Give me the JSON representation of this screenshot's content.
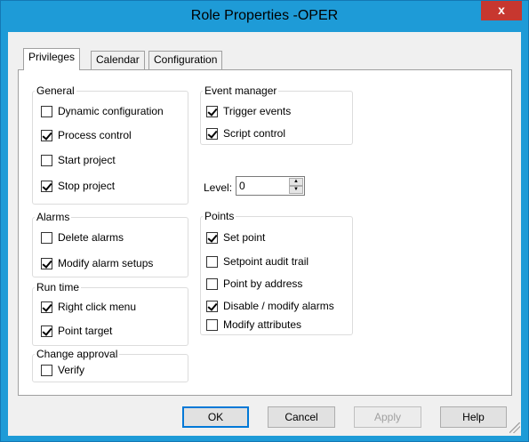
{
  "window": {
    "title": "Role Properties -OPER",
    "close_glyph": "x"
  },
  "tabs": [
    {
      "label": "Privileges",
      "active": true
    },
    {
      "label": "Calendar",
      "active": false
    },
    {
      "label": "Configuration",
      "active": false
    }
  ],
  "general": {
    "legend": "General",
    "items": [
      {
        "label": "Dynamic configuration",
        "checked": false
      },
      {
        "label": "Process control",
        "checked": true
      },
      {
        "label": "Start project",
        "checked": false
      },
      {
        "label": "Stop project",
        "checked": true
      }
    ]
  },
  "alarms": {
    "legend": "Alarms",
    "items": [
      {
        "label": "Delete alarms",
        "checked": false
      },
      {
        "label": "Modify alarm setups",
        "checked": true
      }
    ]
  },
  "runtime": {
    "legend": "Run time",
    "items": [
      {
        "label": "Right click menu",
        "checked": true
      },
      {
        "label": "Point target",
        "checked": true
      }
    ]
  },
  "change_approval": {
    "legend": "Change approval",
    "items": [
      {
        "label": "Verify",
        "checked": false
      }
    ]
  },
  "event_manager": {
    "legend": "Event manager",
    "items": [
      {
        "label": "Trigger events",
        "checked": true
      },
      {
        "label": "Script control",
        "checked": true
      }
    ]
  },
  "level": {
    "label": "Level:",
    "value": "0"
  },
  "points": {
    "legend": "Points",
    "items": [
      {
        "label": "Set point",
        "checked": true
      },
      {
        "label": "Setpoint audit trail",
        "checked": false
      },
      {
        "label": "Point by address",
        "checked": false
      },
      {
        "label": "Disable / modify alarms",
        "checked": true
      },
      {
        "label": "Modify attributes",
        "checked": false
      }
    ]
  },
  "buttons": {
    "ok": "OK",
    "cancel": "Cancel",
    "apply": "Apply",
    "help": "Help"
  }
}
